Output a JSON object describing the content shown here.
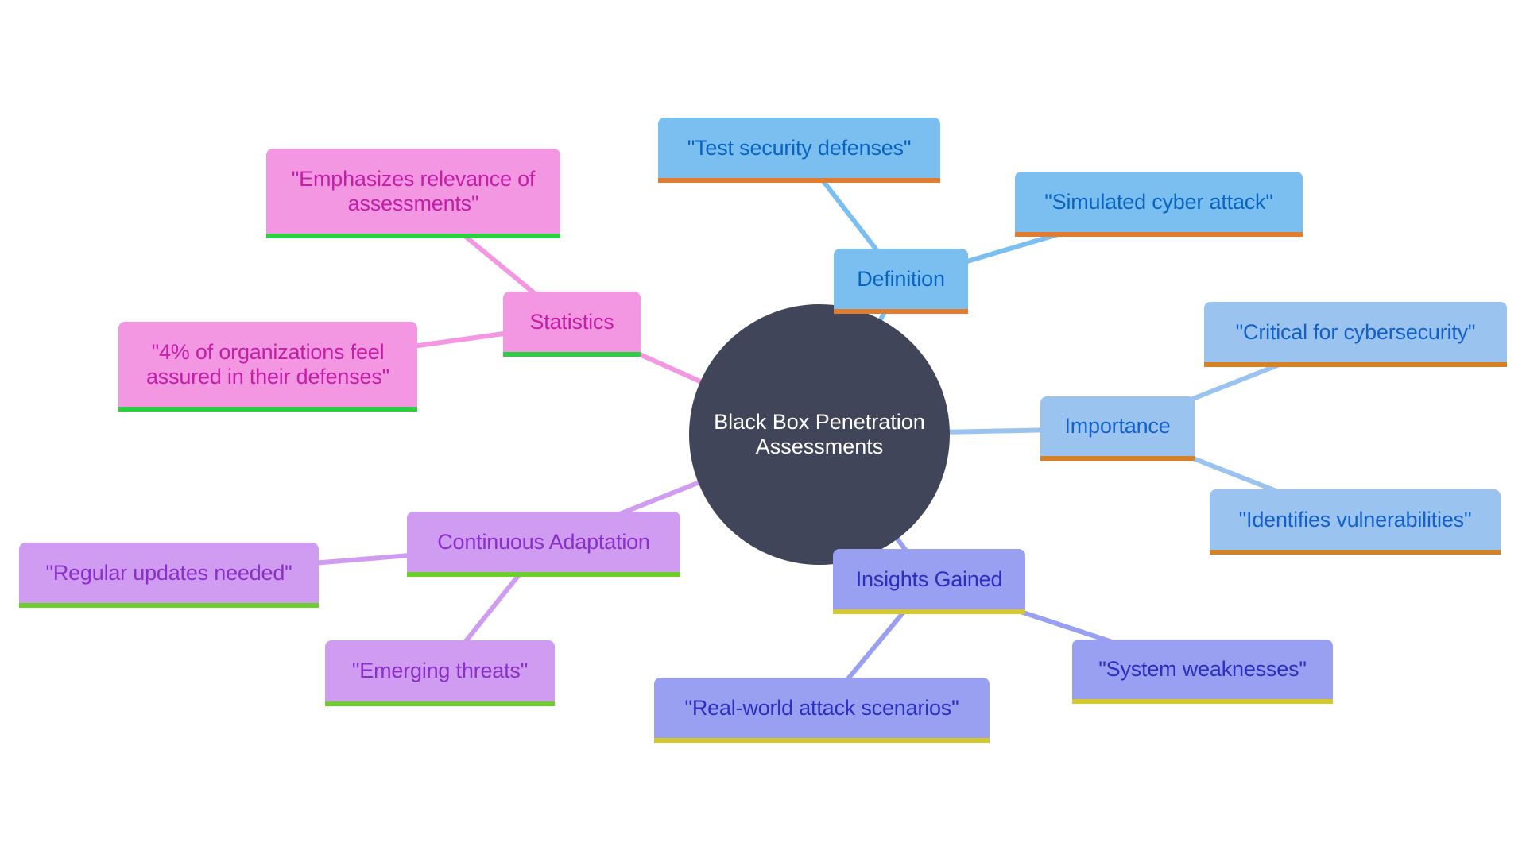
{
  "root": {
    "label": "Black Box Penetration Assessments",
    "color": "#414559",
    "text_color": "#ffffff"
  },
  "branches": [
    {
      "id": "definition",
      "label": "Definition",
      "fill": "#7bbff0",
      "text": "#0a63c0",
      "bar": "#e27d2f",
      "edge": "#7bbff0",
      "children": [
        "\"Test security defenses\"",
        "\"Simulated cyber attack\""
      ]
    },
    {
      "id": "importance",
      "label": "Importance",
      "fill": "#9bc3ef",
      "text": "#1360cc",
      "bar": "#d58126",
      "edge": "#9bc3ef",
      "children": [
        "\"Critical for cybersecurity\"",
        "\"Identifies vulnerabilities\""
      ]
    },
    {
      "id": "insights",
      "label": "Insights Gained",
      "fill": "#9aa0f1",
      "text": "#2a2fc2",
      "bar": "#d4c82a",
      "edge": "#9aa0f1",
      "children": [
        "\"Real-world attack scenarios\"",
        "\"System weaknesses\""
      ]
    },
    {
      "id": "adaptation",
      "label": "Continuous Adaptation",
      "fill": "#cf9cf1",
      "text": "#8a2fc9",
      "bar": "#6ccf2a",
      "edge": "#cf9cf1",
      "children": [
        "\"Regular updates needed\"",
        "\"Emerging threats\""
      ]
    },
    {
      "id": "statistics",
      "label": "Statistics",
      "fill": "#f497e2",
      "text": "#c31ea6",
      "bar": "#2ccf3f",
      "edge": "#f497e2",
      "children": [
        "\"Emphasizes relevance of assessments\"",
        "\"4% of organizations feel assured in their defenses\""
      ]
    }
  ]
}
